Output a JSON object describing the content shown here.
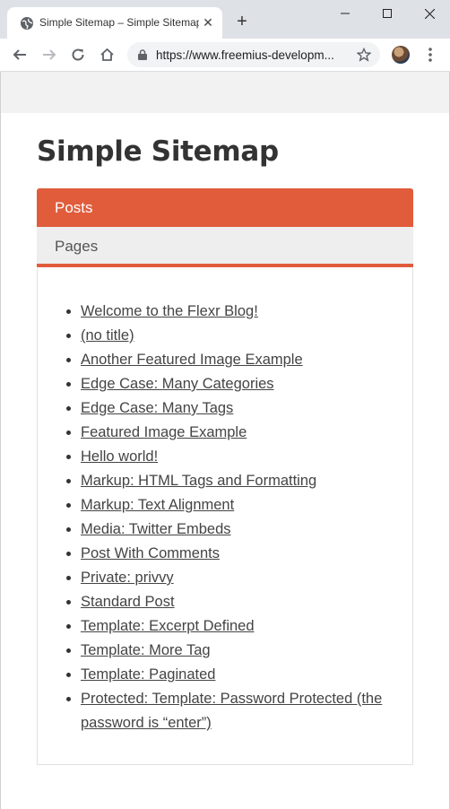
{
  "browser": {
    "tab_title": "Simple Sitemap – Simple Sitemap",
    "new_tab_label": "+",
    "url": "https://www.freemius-developm..."
  },
  "page": {
    "title": "Simple Sitemap",
    "tabs": {
      "posts": "Posts",
      "pages": "Pages"
    },
    "links": [
      "Welcome to the Flexr Blog!",
      "(no title)",
      "Another Featured Image Example",
      "Edge Case: Many Categories",
      "Edge Case: Many Tags",
      "Featured Image Example",
      "Hello world!",
      "Markup: HTML Tags and Formatting",
      "Markup: Text Alignment",
      "Media: Twitter Embeds",
      "Post With Comments",
      "Private: privvy",
      "Standard Post",
      "Template: Excerpt Defined",
      "Template: More Tag",
      "Template: Paginated",
      "Protected: Template: Password Protected (the password is “enter”)"
    ]
  },
  "colors": {
    "accent": "#e05c3b",
    "tab_inactive_bg": "#eeeeee",
    "chrome_bg": "#dee1e6"
  }
}
